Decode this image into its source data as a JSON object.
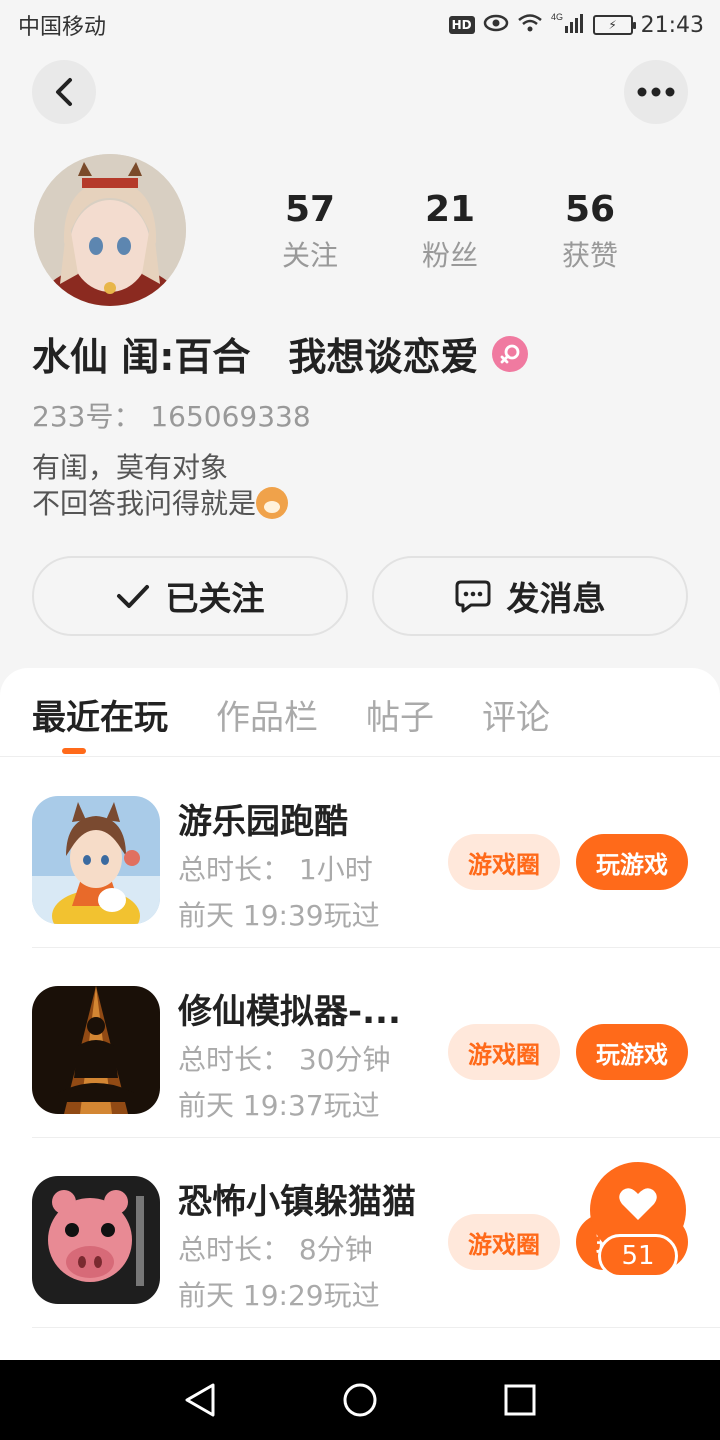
{
  "status_bar": {
    "carrier": "中国移动",
    "hd": "HD",
    "network": "4G",
    "time": "21:43"
  },
  "profile": {
    "stats": [
      {
        "value": "57",
        "label": "关注"
      },
      {
        "value": "21",
        "label": "粉丝"
      },
      {
        "value": "56",
        "label": "获赞"
      }
    ],
    "nickname": "水仙 闺:百合　我想谈恋爱",
    "gender_icon": "female-icon",
    "uid": "233号：  165069338",
    "bio_line1": "有闺，莫有对象",
    "bio_line2": "不回答我问得就是"
  },
  "actions": {
    "follow_label": "已关注",
    "message_label": "发消息"
  },
  "tabs": [
    {
      "label": "最近在玩",
      "active": true
    },
    {
      "label": "作品栏",
      "active": false
    },
    {
      "label": "帖子",
      "active": false
    },
    {
      "label": "评论",
      "active": false
    }
  ],
  "games": [
    {
      "name": "游乐园跑酷",
      "duration": "总时长：  1小时",
      "last_played": "前天 19:39玩过",
      "circle_label": "游戏圈",
      "play_label": "玩游戏"
    },
    {
      "name": "修仙模拟器-...",
      "duration": "总时长：  30分钟",
      "last_played": "前天 19:37玩过",
      "circle_label": "游戏圈",
      "play_label": "玩游戏"
    },
    {
      "name": "恐怖小镇躲猫猫",
      "duration": "总时长：  8分钟",
      "last_played": "前天 19:29玩过",
      "circle_label": "游戏圈",
      "play_label": "玩游戏"
    }
  ],
  "like_widget": {
    "count": "51"
  },
  "colors": {
    "accent": "#ff6a1a",
    "accent_light": "#ffe8db",
    "gender": "#f07aa0"
  }
}
